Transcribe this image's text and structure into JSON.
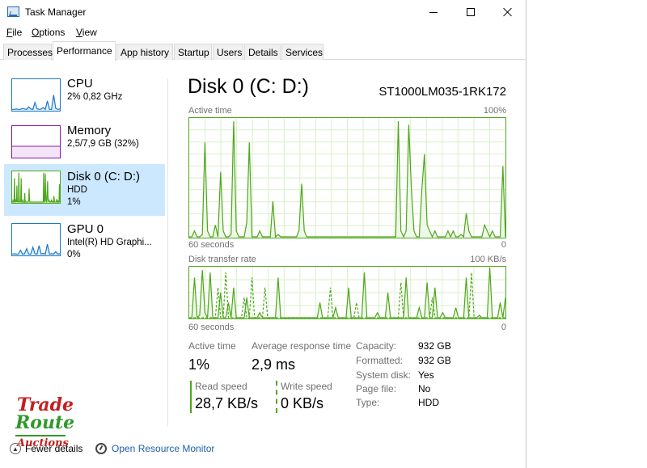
{
  "window": {
    "title": "Task Manager"
  },
  "menu": {
    "file": "File",
    "options": "Options",
    "view": "View"
  },
  "tabs": [
    {
      "label": "Processes"
    },
    {
      "label": "Performance"
    },
    {
      "label": "App history"
    },
    {
      "label": "Startup"
    },
    {
      "label": "Users"
    },
    {
      "label": "Details"
    },
    {
      "label": "Services"
    }
  ],
  "sidebar": {
    "items": [
      {
        "name": "CPU",
        "sub1": "2% 0,82 GHz",
        "sub2": ""
      },
      {
        "name": "Memory",
        "sub1": "2,5/7,9 GB (32%)",
        "sub2": ""
      },
      {
        "name": "Disk 0 (C: D:)",
        "sub1": "HDD",
        "sub2": "1%"
      },
      {
        "name": "GPU 0",
        "sub1": "Intel(R) HD Graphi...",
        "sub2": "0%"
      }
    ]
  },
  "main": {
    "heading": "Disk 0 (C: D:)",
    "model": "ST1000LM035-1RK172",
    "active_graph": {
      "label": "Active time",
      "max": "100%",
      "time_label": "60 seconds",
      "min": "0"
    },
    "transfer_graph": {
      "label": "Disk transfer rate",
      "max": "100 KB/s",
      "time_label": "60 seconds",
      "min": "0"
    },
    "stats": {
      "active_time_label": "Active time",
      "active_time_value": "1%",
      "avg_response_label": "Average response time",
      "avg_response_value": "2,9 ms",
      "read_speed_label": "Read speed",
      "read_speed_value": "28,7 KB/s",
      "write_speed_label": "Write speed",
      "write_speed_value": "0 KB/s"
    },
    "properties": [
      {
        "label": "Capacity:",
        "value": "932 GB"
      },
      {
        "label": "Formatted:",
        "value": "932 GB"
      },
      {
        "label": "System disk:",
        "value": "Yes"
      },
      {
        "label": "Page file:",
        "value": "No"
      },
      {
        "label": "Type:",
        "value": "HDD"
      }
    ]
  },
  "footer": {
    "fewer_details": "Fewer details",
    "open_monitor": "Open Resource Monitor"
  },
  "watermark": {
    "line1": "Trade",
    "line2": "Route",
    "line3": "Auctions"
  },
  "series": {
    "active_time_percent": [
      0,
      0,
      5,
      0,
      0,
      2,
      80,
      5,
      0,
      0,
      10,
      0,
      55,
      5,
      0,
      0,
      2,
      98,
      5,
      0,
      0,
      0,
      12,
      80,
      0,
      0,
      0,
      5,
      0,
      0,
      0,
      0,
      30,
      0,
      2,
      0,
      0,
      0,
      0,
      0,
      0,
      0,
      5,
      45,
      5,
      0,
      0,
      0,
      0,
      0,
      0,
      0,
      0,
      0,
      0,
      0,
      0,
      0,
      0,
      0,
      0,
      0,
      0,
      0,
      0,
      0,
      0,
      0,
      0,
      0,
      0,
      0,
      0,
      0,
      0,
      0,
      0,
      0,
      0,
      0,
      98,
      5,
      0,
      5,
      95,
      40,
      5,
      0,
      0,
      40,
      70,
      10,
      5,
      0,
      5,
      0,
      0,
      0,
      0,
      5,
      0,
      5,
      0,
      0,
      2,
      0,
      20,
      5,
      0,
      0,
      0,
      0,
      0,
      10,
      5,
      0,
      5,
      0,
      0,
      0,
      60,
      0
    ],
    "read_speed_fraction": [
      0,
      0,
      80,
      0,
      5,
      95,
      10,
      0,
      90,
      0,
      0,
      0,
      50,
      0,
      0,
      30,
      0,
      60,
      0,
      0,
      0,
      0,
      40,
      0,
      0,
      0,
      0,
      10,
      0,
      0,
      0,
      0,
      0,
      0,
      80,
      0,
      0,
      0,
      0,
      0,
      0,
      0,
      0,
      0,
      0,
      0,
      0,
      0,
      0,
      0,
      30,
      0,
      0,
      0,
      0,
      0,
      20,
      0,
      0,
      0,
      0,
      60,
      0,
      0,
      0,
      0,
      0,
      90,
      0,
      0,
      0,
      0,
      10,
      0,
      0,
      0,
      50,
      0,
      0,
      0,
      0,
      0,
      0,
      80,
      0,
      0,
      0,
      0,
      20,
      0,
      0,
      70,
      0,
      0,
      60,
      0,
      0,
      10,
      0,
      0,
      0,
      0,
      20,
      0,
      0,
      0,
      80,
      0,
      0,
      0,
      0,
      5,
      0,
      0,
      0,
      100,
      0,
      0,
      0,
      30,
      0,
      40
    ],
    "write_speed_fraction": [
      0,
      0,
      0,
      0,
      0,
      0,
      0,
      0,
      0,
      0,
      0,
      60,
      0,
      0,
      90,
      0,
      0,
      0,
      0,
      0,
      0,
      40,
      0,
      0,
      80,
      0,
      0,
      0,
      0,
      60,
      0,
      0,
      0,
      0,
      0,
      0,
      0,
      0,
      0,
      0,
      0,
      0,
      0,
      0,
      0,
      0,
      0,
      0,
      0,
      0,
      0,
      0,
      0,
      0,
      60,
      0,
      0,
      0,
      0,
      0,
      0,
      0,
      0,
      0,
      30,
      0,
      0,
      0,
      0,
      0,
      0,
      0,
      0,
      0,
      0,
      0,
      0,
      0,
      0,
      0,
      0,
      70,
      0,
      0,
      0,
      0,
      0,
      0,
      0,
      0,
      0,
      0,
      0,
      40,
      0,
      0,
      0,
      0,
      0,
      0,
      0,
      0,
      0,
      0,
      0,
      0,
      0,
      0,
      90,
      0,
      0,
      0,
      0,
      0,
      0,
      0,
      0,
      0,
      0,
      0,
      0,
      0
    ],
    "cpu_percent": [
      2,
      2,
      3,
      2,
      2,
      5,
      3,
      2,
      10,
      3,
      2,
      25,
      4,
      2,
      3,
      8,
      2,
      30,
      2,
      2,
      50,
      5,
      2,
      3
    ],
    "gpu_percent": [
      2,
      3,
      2,
      2,
      15,
      2,
      3,
      20,
      2,
      2,
      25,
      3,
      2,
      30,
      2,
      4,
      2,
      35,
      2,
      3,
      2,
      10,
      2,
      3
    ]
  },
  "colors": {
    "disk_green": "#4da71a",
    "disk_fill": "#eff8e8",
    "cpu_blue": "#1979ca",
    "memory_purple": "#8b12ae",
    "selected_bg": "#cce8ff",
    "link_blue": "#1f5fb0"
  }
}
